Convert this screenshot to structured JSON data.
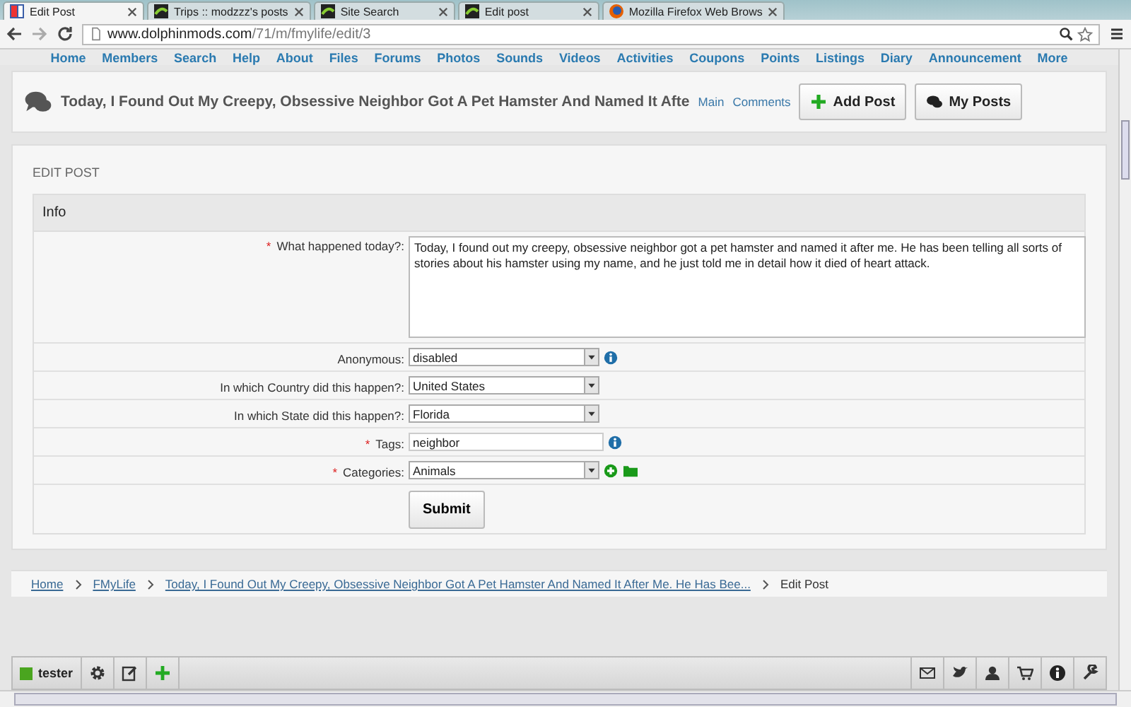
{
  "browser": {
    "tabs": [
      {
        "title": "Edit Post",
        "kind": "page",
        "selected": true
      },
      {
        "title": "Trips :: modzzz's posts",
        "kind": "site",
        "selected": false
      },
      {
        "title": "Site Search",
        "kind": "site",
        "selected": false
      },
      {
        "title": "Edit post",
        "kind": "site",
        "selected": false
      },
      {
        "title": "Mozilla Firefox Web Brows",
        "kind": "browser",
        "selected": false
      }
    ],
    "url_host": "www.dolphinmods.com",
    "url_path": "/71/m/fmylife/edit/3"
  },
  "nav": [
    "Home",
    "Members",
    "Search",
    "Help",
    "About",
    "Files",
    "Forums",
    "Photos",
    "Sounds",
    "Videos",
    "Activities",
    "Coupons",
    "Points",
    "Listings",
    "Diary",
    "Announcement",
    "More"
  ],
  "header": {
    "title": "Today, I Found Out My Creepy, Obsessive Neighbor Got A Pet Hamster And Named It Afte",
    "links": [
      "Main",
      "Comments"
    ],
    "buttons": [
      {
        "label": "Add Post",
        "kind": "add"
      },
      {
        "label": "My Posts",
        "kind": "posts"
      }
    ]
  },
  "panel": {
    "title": "EDIT POST",
    "section": "Info",
    "required_mark": "*",
    "fields": [
      {
        "label": "What happened today?:",
        "kind": "textarea",
        "required": true,
        "value": "Today, I found out my creepy, obsessive neighbor got a pet hamster and named it after me. He has been telling all sorts of stories about his hamster using my name, and he just told me in detail how it died of heart attack.",
        "has_info": false,
        "has_add": false
      },
      {
        "label": "Anonymous:",
        "kind": "select",
        "required": false,
        "value": "disabled",
        "has_info": true,
        "has_add": false
      },
      {
        "label": "In which Country did this happen?:",
        "kind": "select",
        "required": false,
        "value": "United States",
        "has_info": false,
        "has_add": false
      },
      {
        "label": "In which State did this happen?:",
        "kind": "select",
        "required": false,
        "value": "Florida",
        "has_info": false,
        "has_add": false
      },
      {
        "label": "Tags:",
        "kind": "text",
        "required": true,
        "value": "neighbor",
        "has_info": true,
        "has_add": false
      },
      {
        "label": "Categories:",
        "kind": "select",
        "required": true,
        "value": "Animals",
        "has_info": false,
        "has_add": true
      }
    ],
    "submit": "Submit"
  },
  "breadcrumb": [
    "Home",
    "FMyLife",
    "Today, I Found Out My Creepy, Obsessive Neighbor Got A Pet Hamster And Named It After Me. He Has Bee...",
    "Edit Post"
  ],
  "toolbar": {
    "user": "tester"
  }
}
